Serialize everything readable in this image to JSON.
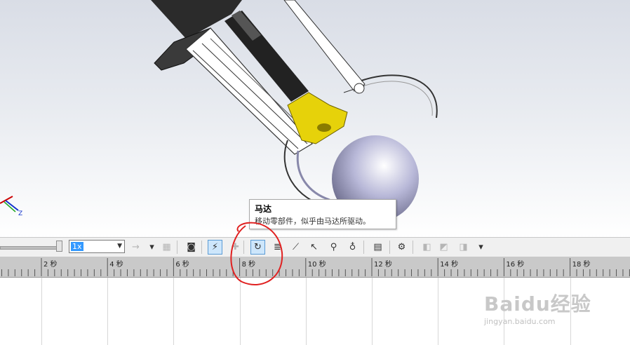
{
  "tooltip": {
    "title": "马达",
    "description": "移动零部件，似乎由马达所驱动。"
  },
  "toolbar": {
    "playback_speed": "1x",
    "items": [
      {
        "name": "forward-arrow-icon",
        "glyph": "→",
        "enabled": false
      },
      {
        "name": "dropdown-arrow-icon",
        "glyph": "▾",
        "enabled": true
      },
      {
        "name": "save-animation-icon",
        "glyph": "▦",
        "enabled": false
      },
      {
        "name": "animation-wizard-icon",
        "glyph": "◙",
        "enabled": true
      },
      {
        "name": "autokey-icon",
        "glyph": "⚡",
        "enabled": true,
        "active": true
      },
      {
        "name": "add-key-icon",
        "glyph": "✚",
        "enabled": false
      },
      {
        "name": "motor-icon",
        "glyph": "↻",
        "enabled": true,
        "active": true
      },
      {
        "name": "spring-icon",
        "glyph": "≣",
        "enabled": true
      },
      {
        "name": "damper-icon",
        "glyph": "⟋",
        "enabled": true
      },
      {
        "name": "force-icon",
        "glyph": "↖",
        "enabled": true
      },
      {
        "name": "contact-icon",
        "glyph": "⚲",
        "enabled": true
      },
      {
        "name": "gravity-icon",
        "glyph": "♁",
        "enabled": true
      },
      {
        "name": "results-plots-icon",
        "glyph": "▤",
        "enabled": true
      },
      {
        "name": "motion-study-properties-icon",
        "glyph": "⚙",
        "enabled": true
      },
      {
        "name": "view-cube-icon",
        "glyph": "◧",
        "enabled": false
      },
      {
        "name": "view-cubes-icon",
        "glyph": "◩",
        "enabled": false
      },
      {
        "name": "view-options-icon",
        "glyph": "◨",
        "enabled": false
      },
      {
        "name": "more-dropdown-icon",
        "glyph": "▾",
        "enabled": true
      }
    ]
  },
  "timeline": {
    "ticks": [
      "2 秒",
      "4 秒",
      "6 秒",
      "8 秒",
      "10 秒",
      "12 秒",
      "14 秒",
      "16 秒",
      "18 秒"
    ]
  },
  "watermark": {
    "logo": "Baidu经验",
    "url": "jingyan.baidu.com"
  },
  "triad": {
    "z_label": "Z"
  },
  "colors": {
    "accent": "#3399ff",
    "annotation": "#e02020",
    "bracket": "#e6d20a",
    "sphere": "#b8b8d8"
  }
}
